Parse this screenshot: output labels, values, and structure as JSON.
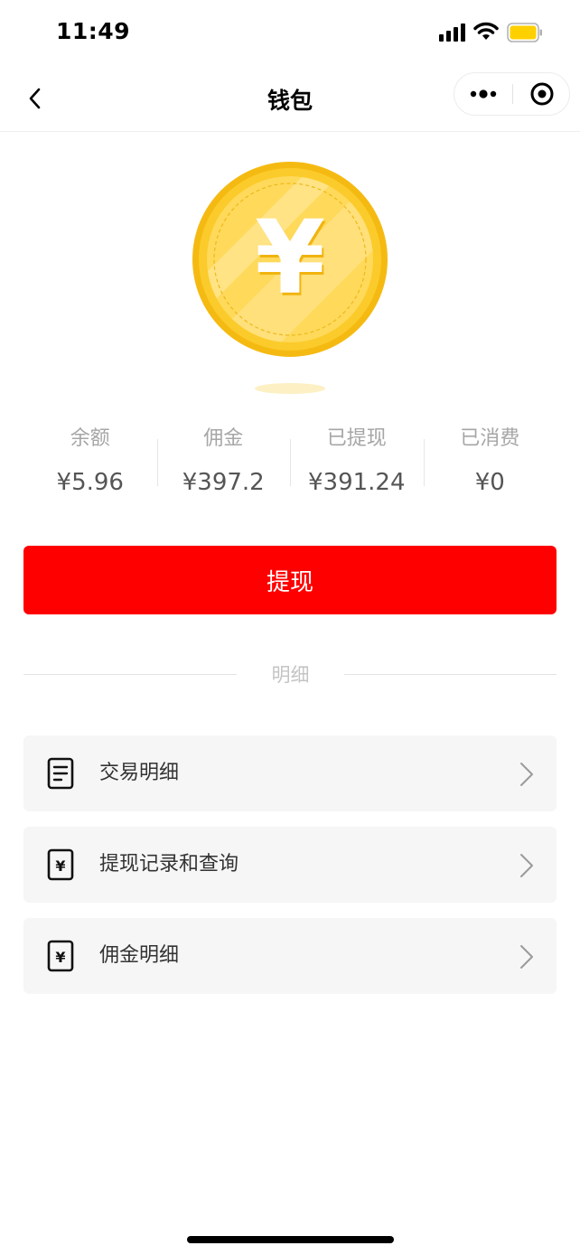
{
  "status_bar": {
    "time": "11:49",
    "icons": [
      "signal-icon",
      "wifi-icon",
      "battery-icon"
    ],
    "battery_color": "#FFD000"
  },
  "nav": {
    "title": "钱包",
    "back_icon": "chevron-left-icon",
    "more_icon": "more-dots-icon",
    "close_icon": "target-circle-icon"
  },
  "coin": {
    "icon": "yuan-coin-icon",
    "symbol": "¥",
    "colors": {
      "outer": "#F8C21A",
      "inner": "#FFDC66",
      "symbol": "#ffffff"
    }
  },
  "stats": [
    {
      "label": "余额",
      "value": "¥5.96"
    },
    {
      "label": "佣金",
      "value": "¥397.2"
    },
    {
      "label": "已提现",
      "value": "¥391.24"
    },
    {
      "label": "已消费",
      "value": "¥0"
    }
  ],
  "withdraw_button": {
    "label": "提现",
    "color": "#FF0000"
  },
  "section_divider": {
    "label": "明细"
  },
  "menu": [
    {
      "label": "交易明细",
      "icon": "document-icon"
    },
    {
      "label": "提现记录和查询",
      "icon": "yuan-receipt-icon"
    },
    {
      "label": "佣金明细",
      "icon": "yuan-receipt-icon"
    }
  ]
}
